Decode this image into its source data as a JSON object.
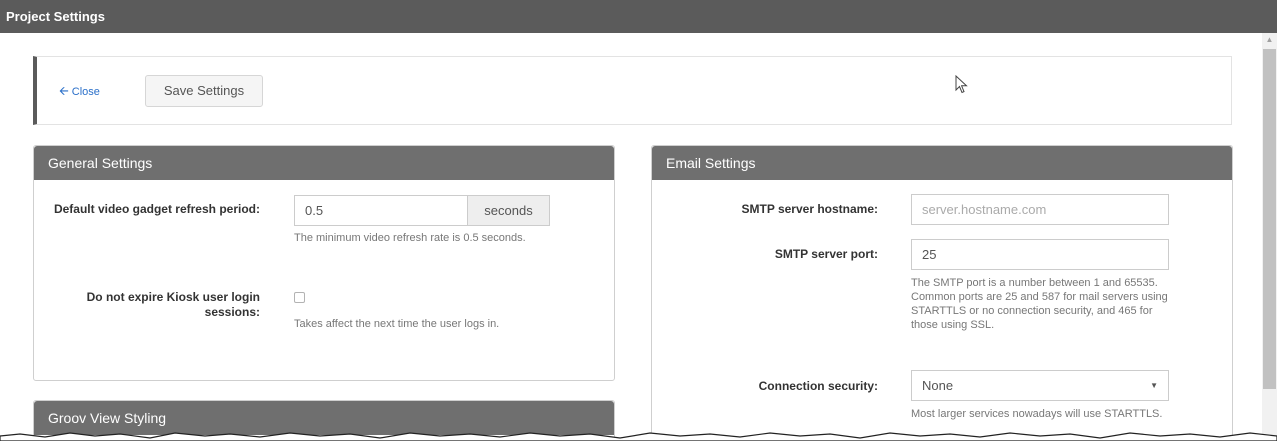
{
  "window": {
    "title": "Project Settings"
  },
  "toolbar": {
    "close_label": "Close",
    "close_icon": "arrow-left-icon",
    "save_label": "Save Settings"
  },
  "general": {
    "title": "General Settings",
    "refresh_label": "Default video gadget refresh period:",
    "refresh_value": "0.5",
    "refresh_unit": "seconds",
    "refresh_help": "The minimum video refresh rate is 0.5 seconds.",
    "kiosk_label": "Do not expire Kiosk user login sessions:",
    "kiosk_checked": false,
    "kiosk_help": "Takes affect the next time the user logs in."
  },
  "email": {
    "title": "Email Settings",
    "hostname_label": "SMTP server hostname:",
    "hostname_value": "",
    "hostname_placeholder": "server.hostname.com",
    "port_label": "SMTP server port:",
    "port_value": "25",
    "port_help": "The SMTP port is a number between 1 and 65535. Common ports are 25 and 587 for mail servers using STARTTLS or no connection security, and 465 for those using SSL.",
    "security_label": "Connection security:",
    "security_value": "None",
    "security_help": "Most larger services nowadays will use STARTTLS."
  },
  "groov": {
    "title": "Groov View Styling"
  }
}
